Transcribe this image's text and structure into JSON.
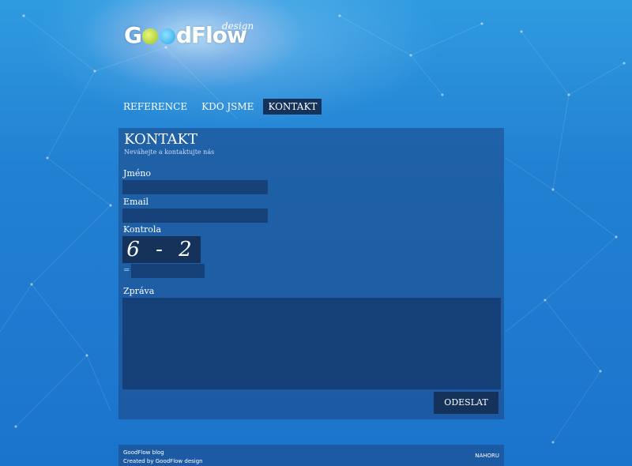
{
  "colors": {
    "background": "#1b74cc",
    "panel": "#1e4682",
    "dark_accent": "#14325a"
  },
  "logo": {
    "part1": "G",
    "part2": "dFlow",
    "sub": "design"
  },
  "nav": {
    "items": [
      {
        "label": "REFERENCE",
        "active": false
      },
      {
        "label": "KDO JSME",
        "active": false
      },
      {
        "label": "KONTAKT",
        "active": true
      }
    ]
  },
  "page": {
    "title": "KONTAKT",
    "subtitle": "Neváhejte a kontaktujte nás"
  },
  "form": {
    "name_label": "Jméno",
    "email_label": "Email",
    "check_label": "Kontrola",
    "captcha_text": "6 - 2",
    "equals": "=",
    "message_label": "Zpráva",
    "submit_label": "ODESLAT"
  },
  "footer": {
    "line1": "GoodFlow blog",
    "line2": "Created by GoodFlow design",
    "top_link": "NAHORU"
  }
}
